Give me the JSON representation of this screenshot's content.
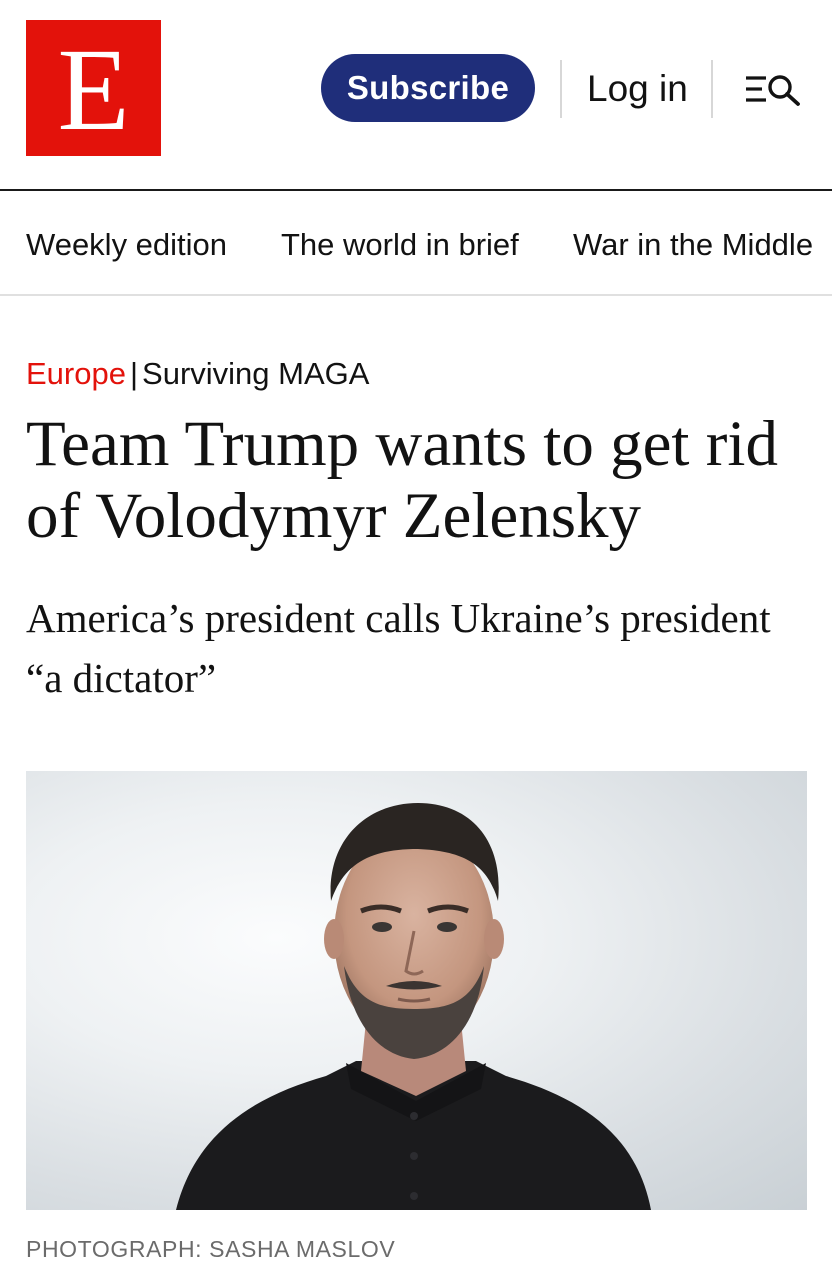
{
  "header": {
    "logo_letter": "E",
    "subscribe_label": "Subscribe",
    "login_label": "Log in",
    "brand_color": "#e3120b",
    "subscribe_color": "#1f2e7a"
  },
  "nav": {
    "items": [
      "Weekly edition",
      "The world in brief",
      "War in the Middle"
    ]
  },
  "article": {
    "section": "Europe",
    "separator": "|",
    "series": "Surviving MAGA",
    "headline": "Team Trump wants to get rid of Volodymyr Zelensky",
    "standfirst": "America’s president calls Ukraine’s president “a dictator”",
    "photo_caption": "PHOTOGRAPH: SASHA MASLOV"
  },
  "icons": {
    "menu_search": "menu-search-icon"
  }
}
